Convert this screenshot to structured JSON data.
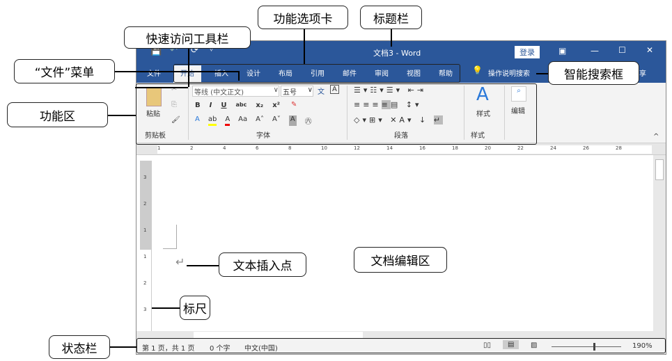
{
  "window": {
    "title": "文档3  -  Word",
    "login": "登录",
    "qat": [
      "💾",
      "↶",
      "⟳",
      "▿"
    ],
    "win_controls": [
      "▣",
      "—",
      "☐",
      "✕"
    ]
  },
  "tabs": [
    "文件",
    "开始",
    "插入",
    "设计",
    "布局",
    "引用",
    "邮件",
    "审阅",
    "视图",
    "帮助"
  ],
  "search": {
    "label": "操作说明搜索",
    "share": "享"
  },
  "ribbon": {
    "clipboard": {
      "label": "剪贴板",
      "paste": "粘贴"
    },
    "font": {
      "label": "字体",
      "font_name": "等线 (中文正文)",
      "font_size": "五号",
      "row2": [
        "B",
        "I",
        "U",
        "abc",
        "x₂",
        "x²"
      ],
      "row3": [
        "A",
        "A",
        "Aa",
        "A˄",
        "A˅",
        "A",
        "㊅"
      ]
    },
    "paragraph": {
      "label": "段落"
    },
    "styles": {
      "label": "样式",
      "btn": "样式"
    },
    "editing": {
      "btn": "编辑"
    }
  },
  "ruler": {
    "h_numbers": [
      "1",
      "2",
      "4",
      "6",
      "8",
      "10",
      "12",
      "14",
      "16",
      "18",
      "20",
      "22",
      "24",
      "26",
      "28"
    ],
    "v_numbers": [
      "3",
      "2",
      "1",
      "1",
      "2",
      "3"
    ]
  },
  "status": {
    "page": "第 1 页，共 1 页",
    "words": "0 个字",
    "lang": "中文(中国)",
    "zoom": "190%"
  },
  "callouts": {
    "title_bar": "标题栏",
    "tabs": "功能选项卡",
    "qat": "快速访问工具栏",
    "file_menu": "“文件”菜单",
    "ribbon": "功能区",
    "search_box": "智能搜索框",
    "insertion_point": "文本插入点",
    "doc_area": "文档编辑区",
    "ruler": "标尺",
    "status_bar": "状态栏"
  },
  "colors": {
    "accent": "#2b579a",
    "ribbon": "#f3f3f3"
  }
}
